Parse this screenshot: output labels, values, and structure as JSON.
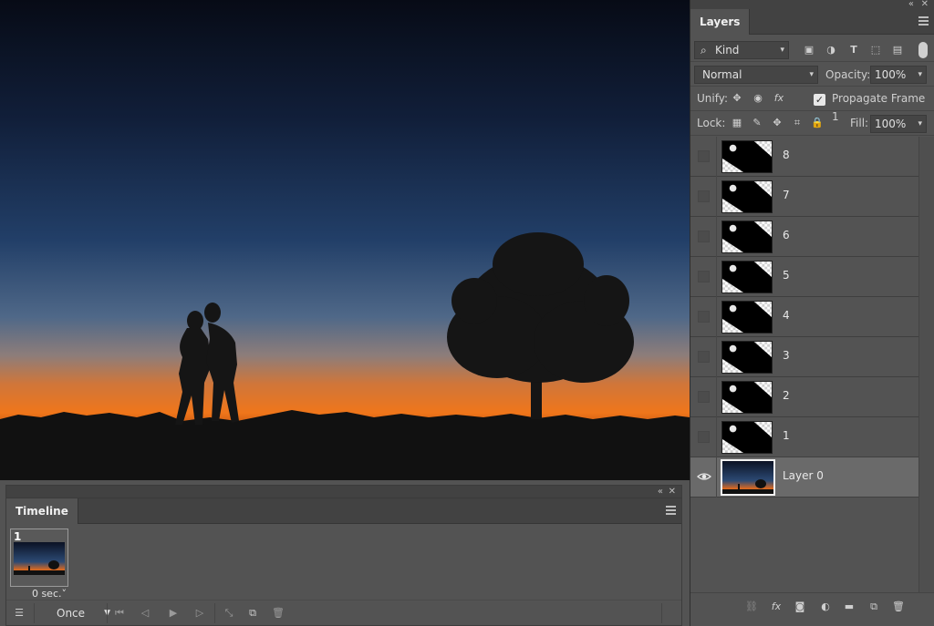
{
  "layers_panel": {
    "tab_label": "Layers",
    "filter_kind": "Kind",
    "blend_mode": "Normal",
    "opacity_label": "Opacity:",
    "opacity_value": "100%",
    "unify_label": "Unify:",
    "propagate_label": "Propagate Frame 1",
    "propagate_checked": true,
    "lock_label": "Lock:",
    "fill_label": "Fill:",
    "fill_value": "100%",
    "layers": [
      {
        "name": "8",
        "visible": false,
        "selected": false
      },
      {
        "name": "7",
        "visible": false,
        "selected": false
      },
      {
        "name": "6",
        "visible": false,
        "selected": false
      },
      {
        "name": "5",
        "visible": false,
        "selected": false
      },
      {
        "name": "4",
        "visible": false,
        "selected": false
      },
      {
        "name": "3",
        "visible": false,
        "selected": false
      },
      {
        "name": "2",
        "visible": false,
        "selected": false
      },
      {
        "name": "1",
        "visible": false,
        "selected": false
      },
      {
        "name": "Layer 0",
        "visible": true,
        "selected": true
      }
    ]
  },
  "timeline_panel": {
    "tab_label": "Timeline",
    "frame_number": "1",
    "frame_delay": "0 sec.",
    "loop_option": "Once"
  },
  "icons": {
    "filter": "search-icon",
    "collapse": "double-chevron-left-icon",
    "close": "close-icon",
    "menu": "hamburger-menu-icon"
  },
  "colors": {
    "panel_bg": "#535353",
    "panel_header": "#424242",
    "selected_layer": "#6a6a6a",
    "sky_top": "#0a0f1c",
    "sky_mid": "#1e3a62",
    "horizon_orange": "#e26a1b"
  }
}
